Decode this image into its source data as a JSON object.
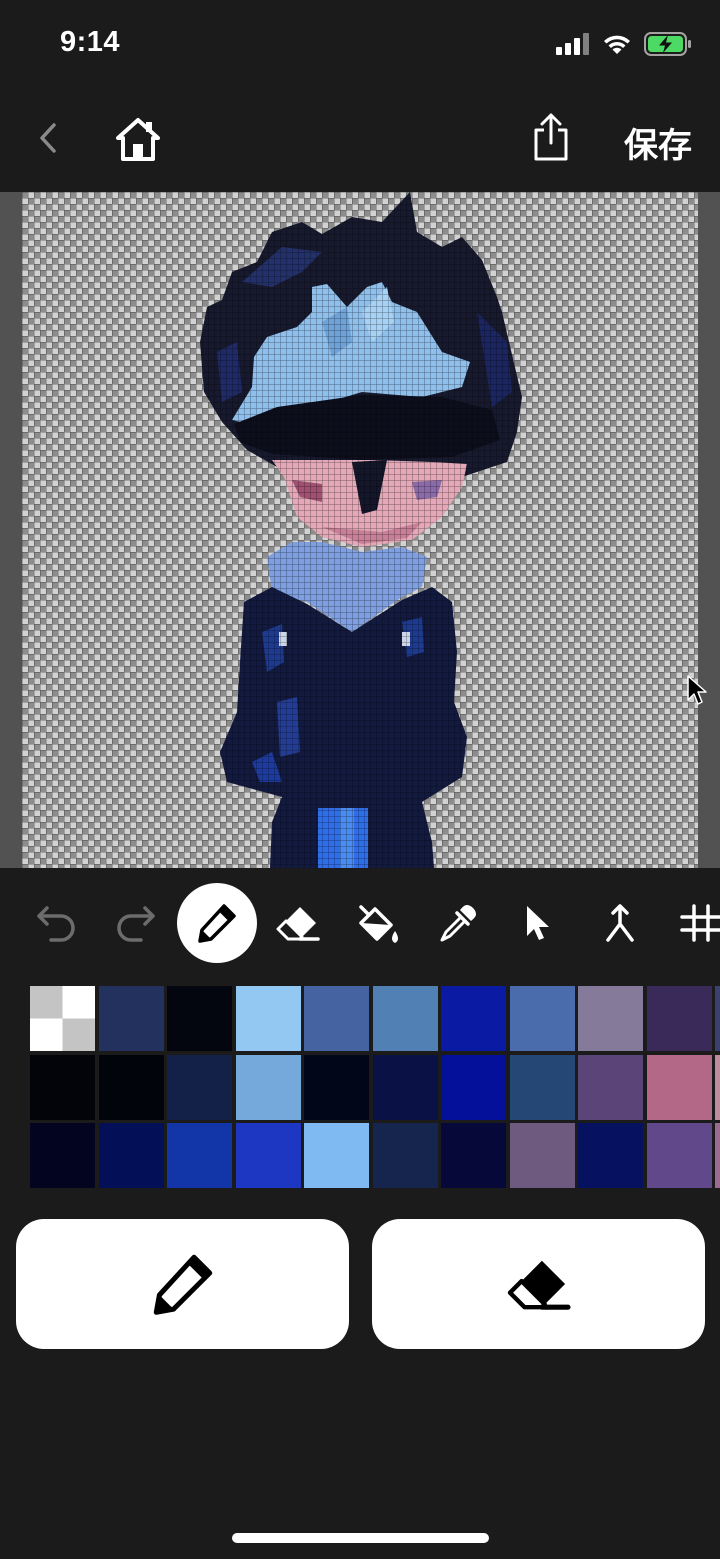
{
  "status": {
    "time": "9:14"
  },
  "nav": {
    "save_label": "保存"
  },
  "toolbar": {
    "tools": [
      {
        "name": "undo-icon",
        "active": false,
        "dim": true
      },
      {
        "name": "redo-icon",
        "active": false,
        "dim": true
      },
      {
        "name": "pencil-icon",
        "active": true,
        "dim": false
      },
      {
        "name": "eraser-icon",
        "active": false,
        "dim": false
      },
      {
        "name": "paint-bucket-icon",
        "active": false,
        "dim": false
      },
      {
        "name": "eyedropper-icon",
        "active": false,
        "dim": false
      },
      {
        "name": "select-pointer-icon",
        "active": false,
        "dim": false
      },
      {
        "name": "merge-icon",
        "active": false,
        "dim": false
      },
      {
        "name": "grid-icon",
        "active": false,
        "dim": false
      }
    ]
  },
  "palette": {
    "rows": [
      [
        "transparent",
        "#22315e",
        "#03060f",
        "#93c8f2",
        "#4563a0",
        "#5180b4",
        "#0a1aa3",
        "#4a6cac",
        "#857a9a",
        "#3a2a5a",
        "#3a4070"
      ],
      [
        "#03040a",
        "#02040b",
        "#132048",
        "#76a9db",
        "#020619",
        "#0a1245",
        "#04109a",
        "#254775",
        "#5a4478",
        "#b46888",
        "#c08aa0"
      ],
      [
        "#020420",
        "#031058",
        "#1235a8",
        "#1d37c2",
        "#7fbaf2",
        "#15254e",
        "#07083a",
        "#6e5a7e",
        "#061260",
        "#60488a",
        "#9a6a90"
      ]
    ]
  },
  "actions": {
    "primary": {
      "icon": "pencil-icon"
    },
    "secondary": {
      "icon": "eraser-icon"
    }
  }
}
